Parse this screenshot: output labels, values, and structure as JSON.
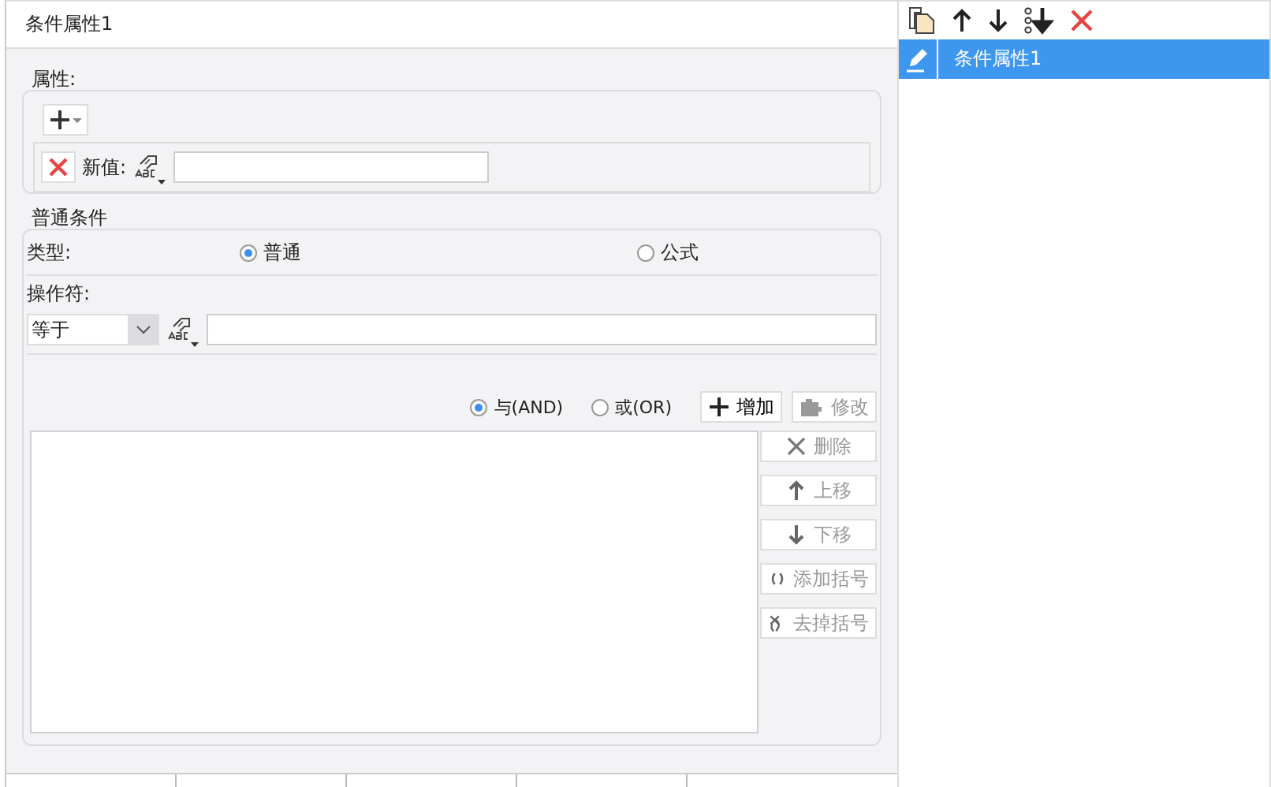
{
  "panel": {
    "title": "条件属性1"
  },
  "properties": {
    "legend": "属性:",
    "new_value_label": "新值:"
  },
  "condition": {
    "legend": "普通条件",
    "type_label": "类型:",
    "type_options": [
      {
        "label": "普通",
        "selected": true
      },
      {
        "label": "公式",
        "selected": false
      }
    ],
    "operator_label": "操作符:",
    "operator": {
      "value": "等于"
    },
    "logic_options": [
      {
        "label": "与(AND)",
        "selected": true
      },
      {
        "label": "或(OR)",
        "selected": false
      }
    ],
    "buttons": [
      {
        "kind": "add",
        "label": "增加",
        "disabled": false
      },
      {
        "kind": "edit",
        "label": "修改",
        "disabled": true
      }
    ],
    "side_buttons": [
      {
        "kind": "delete",
        "label": "删除",
        "disabled": true
      },
      {
        "kind": "up",
        "label": "上移",
        "disabled": true
      },
      {
        "kind": "down",
        "label": "下移",
        "disabled": true
      },
      {
        "kind": "add-brackets",
        "label": "添加括号",
        "disabled": true
      },
      {
        "kind": "remove-brackets",
        "label": "去掉括号",
        "disabled": true
      }
    ]
  },
  "list": {
    "items": [
      {
        "label": "条件属性1",
        "selected": true
      }
    ]
  }
}
